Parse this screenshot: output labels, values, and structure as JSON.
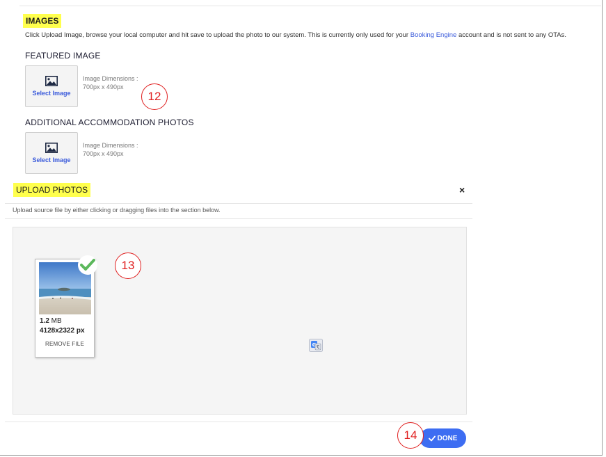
{
  "images_section": {
    "title": "IMAGES",
    "description_before": "Click Upload Image, browse your local computer and hit save to upload the photo to our system. This is currently only used for your ",
    "description_link": "Booking Engine",
    "description_after": " account and is not sent to any OTAs."
  },
  "featured": {
    "title": "FEATURED IMAGE",
    "select_label": "Select Image",
    "dims_label": "Image Dimensions :",
    "dims_value": "700px x 490px"
  },
  "additional": {
    "title": "ADDITIONAL ACCOMMODATION PHOTOS",
    "select_label": "Select Image",
    "dims_label": "Image Dimensions :",
    "dims_value": "700px x 490px"
  },
  "callouts": {
    "c12": "12",
    "c13": "13",
    "c14": "14"
  },
  "upload_modal": {
    "title": "UPLOAD PHOTOS",
    "close": "×",
    "help": "Upload source file by either clicking or dragging files into the section below.",
    "file": {
      "size_value": "1.2",
      "size_unit": " MB",
      "dimensions": "4128x2322 px",
      "remove_label": "REMOVE FILE"
    },
    "done_label": "DONE"
  },
  "colors": {
    "highlight": "#ffff4d",
    "accent_blue": "#3d6df2",
    "link_blue": "#3b5bdb",
    "callout_red": "#e02020",
    "success_green": "#5cb85c"
  },
  "icons": [
    "image-icon",
    "close-icon",
    "check-icon",
    "translate-icon"
  ]
}
